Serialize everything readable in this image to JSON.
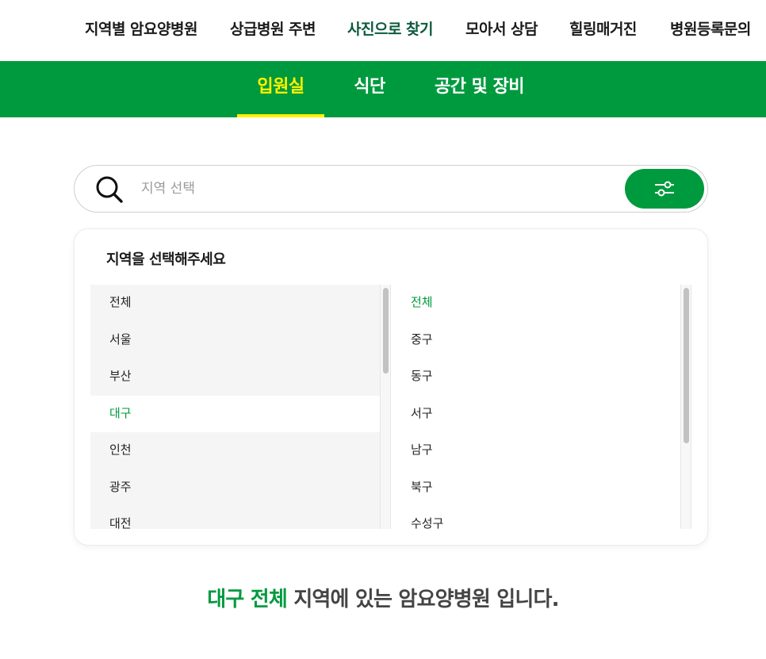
{
  "top_nav": {
    "items": [
      {
        "label": "지역별 암요양병원",
        "active": false
      },
      {
        "label": "상급병원 주변",
        "active": false
      },
      {
        "label": "사진으로 찾기",
        "active": true
      },
      {
        "label": "모아서 상담",
        "active": false
      },
      {
        "label": "힐링매거진",
        "active": false
      },
      {
        "label": "병원등록문의",
        "active": false
      }
    ]
  },
  "sub_nav": {
    "tabs": [
      {
        "label": "입원실",
        "active": true
      },
      {
        "label": "식단",
        "active": false
      },
      {
        "label": "공간 및 장비",
        "active": false
      }
    ]
  },
  "search": {
    "placeholder": "지역 선택",
    "value": "",
    "icon": "search-icon",
    "filter_icon": "sliders-icon"
  },
  "region_panel": {
    "title": "지역을 선택해주세요",
    "provinces": [
      "전체",
      "서울",
      "부산",
      "대구",
      "인천",
      "광주",
      "대전"
    ],
    "selected_province": "대구",
    "districts": [
      "전체",
      "중구",
      "동구",
      "서구",
      "남구",
      "북구",
      "수성구"
    ],
    "selected_district": "전체"
  },
  "result": {
    "region": "대구",
    "district": "전체",
    "suffix": "지역에 있는 암요양병원 입니다."
  },
  "colors": {
    "brand_green": "#009a3e",
    "active_tab_yellow": "#fff200",
    "active_nav_text": "#0b5a3c"
  }
}
